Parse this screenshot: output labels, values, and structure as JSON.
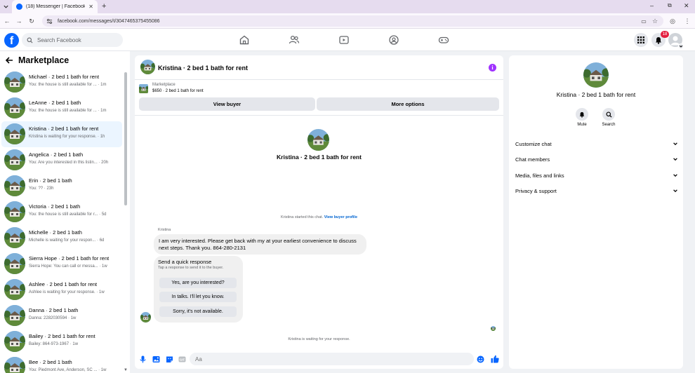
{
  "browser": {
    "tab_title": "(18) Messenger | Facebook",
    "url": "facebook.com/messages/t/3047465375455086"
  },
  "header": {
    "search_placeholder": "Search Facebook",
    "notification_count": "18"
  },
  "sidebar": {
    "title": "Marketplace",
    "conversations": [
      {
        "name": "Michael · 2 bed 1 bath for rent",
        "preview": "You: the house is still available for ... · 1m",
        "selected": false
      },
      {
        "name": "LeAnne · 2 bed 1 bath",
        "preview": "You: the house is still available for ... · 1m",
        "selected": false
      },
      {
        "name": "Kristina · 2 bed 1 bath for rent",
        "preview": "Kristina is waiting for your response. · 1h",
        "selected": true
      },
      {
        "name": "Angelica · 2 bed 1 bath",
        "preview": "You: Are you interested in this listin... · 20h",
        "selected": false
      },
      {
        "name": "Erin · 2 bed 1 bath",
        "preview": "You: ?? · 23h",
        "selected": false
      },
      {
        "name": "Victoria · 2 bed 1 bath",
        "preview": "You: the house is still available for r... · 5d",
        "selected": false
      },
      {
        "name": "Michelle · 2 bed 1 bath",
        "preview": "Michelle is waiting for your respon... · 6d",
        "selected": false
      },
      {
        "name": "Sierra Hope · 2 bed 1 bath for rent",
        "preview": "Sierra Hope: You can call or messa... · 1w",
        "selected": false
      },
      {
        "name": "Ashlee · 2 bed 1 bath for rent",
        "preview": "Ashlee is waiting for your response. · 1w",
        "selected": false
      },
      {
        "name": "Danna · 2 bed 1 bath",
        "preview": "Danna: 2282030594 · 1w",
        "selected": false
      },
      {
        "name": "Bailey · 2 bed 1 bath for rent",
        "preview": "Bailey: 864-973-1967 · 1w",
        "selected": false
      },
      {
        "name": "Bee · 2 bed 1 bath",
        "preview": "You: Piedmont Ave, Anderson, SC ... · 1w",
        "selected": false
      }
    ]
  },
  "chat": {
    "title": "Kristina · 2 bed 1 bath for rent",
    "listing_source": "Marketplace",
    "listing_price": "$650 · 2 bed 1 bath for rent",
    "view_buyer_label": "View buyer",
    "more_options_label": "More options",
    "intro_name": "Kristina · 2 bed 1 bath for rent",
    "started_text": "Kristina started this chat.",
    "view_profile_link": "View buyer profile",
    "sender_name": "Kristina",
    "message_line1": "I am very interested. Please get back with my at your earliest convenience to discuss",
    "message_line2": "next steps. Thank you. 864-280-2131",
    "quick_title": "Send a quick response",
    "quick_subtitle": "Tap a response to send it to the buyer.",
    "quick_options": [
      "Yes, are you interested?",
      "In talks. I'll let you know.",
      "Sorry, it's not available."
    ],
    "waiting_text": "Kristina is waiting for your response.",
    "composer_placeholder": "Aa"
  },
  "details": {
    "name": "Kristina · 2 bed 1 bath for rent",
    "mute_label": "Mute",
    "search_label": "Search",
    "sections": [
      "Customize chat",
      "Chat members",
      "Media, files and links",
      "Privacy & support"
    ]
  },
  "colors": {
    "facebook_blue": "#0866ff",
    "link_blue": "#0064d1",
    "info_purple": "#a033ff",
    "badge_red": "#e41e3f",
    "selected_row": "#ebf5ff"
  },
  "icons": [
    "chevron-down-icon",
    "facebook-logo",
    "search-icon",
    "home-icon",
    "friends-icon",
    "video-icon",
    "groups-icon",
    "gaming-icon",
    "menu-grid-icon",
    "bell-icon",
    "back-arrow-icon",
    "info-icon",
    "microphone-icon",
    "image-icon",
    "sticker-icon",
    "gif-icon",
    "emoji-icon",
    "thumbs-up-icon"
  ]
}
